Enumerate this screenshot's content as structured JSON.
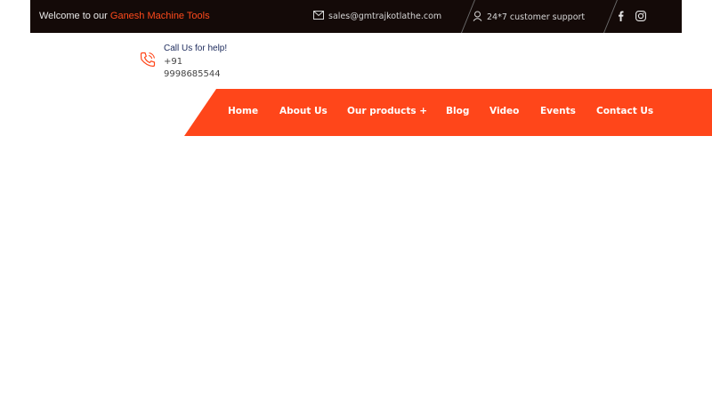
{
  "topbar": {
    "welcome_prefix": "Welcome to our",
    "brand_name": "Ganesh Machine Tools",
    "email": "sales@gmtrajkotlathe.com",
    "support": "24*7 customer support",
    "social": [
      "facebook-icon",
      "instagram-icon"
    ]
  },
  "help": {
    "title": "Call Us for help!",
    "number": "+91 9998685544"
  },
  "nav": {
    "items": [
      "Home",
      "About Us",
      "Our products +",
      "Blog",
      "Video",
      "Events",
      "Contact Us"
    ]
  },
  "colors": {
    "topbar_bg": "#140a08",
    "accent": "#ff461a",
    "brand_text": "#ff4a1c"
  }
}
